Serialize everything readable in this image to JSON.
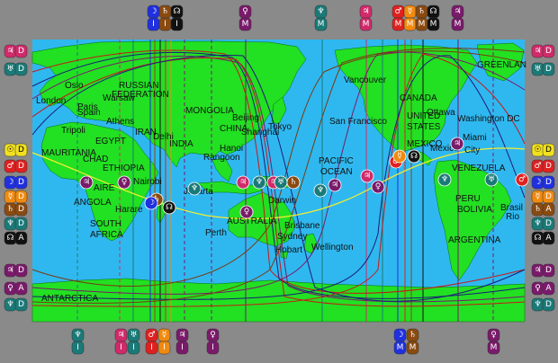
{
  "colors": {
    "ocean": "#2fb8ef",
    "land": "#22e022",
    "frame": "#8a8a8a",
    "grid": "#000000",
    "path_yellow": "#f4ee30",
    "line_red": "#c81818",
    "line_navy": "#1c1c7a",
    "line_purple": "#7a1a6a",
    "line_brown": "#7a3a10"
  },
  "cities": [
    {
      "name": "London"
    },
    {
      "name": "Oslo"
    },
    {
      "name": "Paris"
    },
    {
      "name": "Warsaw"
    },
    {
      "name": "Spain"
    },
    {
      "name": "Athens"
    },
    {
      "name": "Tripoli"
    },
    {
      "name": "EGYPT"
    },
    {
      "name": "IRAN"
    },
    {
      "name": "Delhi"
    },
    {
      "name": "INDIA"
    },
    {
      "name": "CHINA"
    },
    {
      "name": "Beijing"
    },
    {
      "name": "Shanghai"
    },
    {
      "name": "Tokyo"
    },
    {
      "name": "Hanoi"
    },
    {
      "name": "Rangoon"
    },
    {
      "name": "Jakarta"
    },
    {
      "name": "Darwin"
    },
    {
      "name": "Perth"
    },
    {
      "name": "Brisbane"
    },
    {
      "name": "Sydney"
    },
    {
      "name": "Hobart"
    },
    {
      "name": "Wellington"
    },
    {
      "name": "Nairobi"
    },
    {
      "name": "Harare"
    },
    {
      "name": "ETHIOPIA"
    },
    {
      "name": "CHAD"
    },
    {
      "name": "AIRE"
    },
    {
      "name": "Vancouver"
    },
    {
      "name": "San Francisco"
    },
    {
      "name": "Ottawa"
    },
    {
      "name": "Washington DC"
    },
    {
      "name": "Miami"
    },
    {
      "name": "City"
    },
    {
      "name": "Mexico"
    },
    {
      "name": "PERU"
    },
    {
      "name": "Rio"
    }
  ],
  "regions": [
    {
      "name": "RUSSIAN"
    },
    {
      "name": "FEDERATION"
    },
    {
      "name": "MONGOLIA"
    },
    {
      "name": "MAURITANIA"
    },
    {
      "name": "ANGOLA"
    },
    {
      "name": "SOUTH"
    },
    {
      "name": "AFRICA"
    },
    {
      "name": "AUSTRALIA"
    },
    {
      "name": "PACIFIC"
    },
    {
      "name": "OCEAN"
    },
    {
      "name": "CANADA"
    },
    {
      "name": "UNITED"
    },
    {
      "name": "STATES"
    },
    {
      "name": "MEXICO"
    },
    {
      "name": "VENEZUELA"
    },
    {
      "name": "BOLIVIA"
    },
    {
      "name": "Brasil"
    },
    {
      "name": "ARGENTINA"
    },
    {
      "name": "ANTARCTICA"
    },
    {
      "name": "GREENLAN"
    }
  ],
  "left_badges": [
    {
      "sym": "♃",
      "sub": "D",
      "color": "#d02a6a"
    },
    {
      "sym": "♅",
      "sub": "D",
      "color": "#1a7a78"
    },
    {
      "sym": "☉",
      "sub": "D",
      "color": "#f0e020"
    },
    {
      "sym": "♂",
      "sub": "D",
      "color": "#e02020"
    },
    {
      "sym": "☽",
      "sub": "D",
      "color": "#2030e0"
    },
    {
      "sym": "☿",
      "sub": "D",
      "color": "#f08a10"
    },
    {
      "sym": "♄",
      "sub": "D",
      "color": "#8a4a10"
    },
    {
      "sym": "♆",
      "sub": "D",
      "color": "#1a7a78"
    },
    {
      "sym": "☊",
      "sub": "A",
      "color": "#111111"
    },
    {
      "sym": "♃",
      "sub": "D",
      "color": "#7a1a6a"
    },
    {
      "sym": "♀",
      "sub": "A",
      "color": "#7a1a6a"
    },
    {
      "sym": "♆",
      "sub": "D",
      "color": "#1a7a78"
    }
  ],
  "right_badges": [
    {
      "sym": "♃",
      "sub": "D",
      "color": "#d02a6a"
    },
    {
      "sym": "♅",
      "sub": "D",
      "color": "#1a7a78"
    },
    {
      "sym": "☉",
      "sub": "D",
      "color": "#f0e020"
    },
    {
      "sym": "♂",
      "sub": "D",
      "color": "#e02020"
    },
    {
      "sym": "☽",
      "sub": "D",
      "color": "#2030e0"
    },
    {
      "sym": "☿",
      "sub": "D",
      "color": "#f08a10"
    },
    {
      "sym": "♄",
      "sub": "A",
      "color": "#8a4a10"
    },
    {
      "sym": "♆",
      "sub": "D",
      "color": "#1a7a78"
    },
    {
      "sym": "☊",
      "sub": "A",
      "color": "#111111"
    },
    {
      "sym": "♃",
      "sub": "D",
      "color": "#7a1a6a"
    },
    {
      "sym": "♀",
      "sub": "A",
      "color": "#7a1a6a"
    },
    {
      "sym": "♆",
      "sub": "D",
      "color": "#1a7a78"
    }
  ],
  "top_badges": [
    {
      "sym": "☽",
      "sub": "I",
      "color": "#2030e0"
    },
    {
      "sym": "♄",
      "sub": "I",
      "color": "#8a4a10"
    },
    {
      "sym": "☊",
      "sub": "I",
      "color": "#111111"
    },
    {
      "sym": "♀",
      "sub": "M",
      "color": "#7a1a6a"
    },
    {
      "sym": "♆",
      "sub": "M",
      "color": "#1a7a78"
    },
    {
      "sym": "♃",
      "sub": "M",
      "color": "#d02a6a"
    },
    {
      "sym": "♂",
      "sub": "M",
      "color": "#e02020"
    },
    {
      "sym": "☿",
      "sub": "M",
      "color": "#f08a10"
    },
    {
      "sym": "♄",
      "sub": "M",
      "color": "#8a4a10"
    },
    {
      "sym": "☊",
      "sub": "M",
      "color": "#111111"
    },
    {
      "sym": "♃",
      "sub": "M",
      "color": "#7a1a6a"
    }
  ],
  "bottom_badges": [
    {
      "sym": "♆",
      "sub": "I",
      "color": "#1a7a78"
    },
    {
      "sym": "♃",
      "sub": "I",
      "color": "#d02a6a"
    },
    {
      "sym": "♅",
      "sub": "I",
      "color": "#1a7a78"
    },
    {
      "sym": "♂",
      "sub": "I",
      "color": "#e02020"
    },
    {
      "sym": "☿",
      "sub": "I",
      "color": "#f08a10"
    },
    {
      "sym": "♃",
      "sub": "I",
      "color": "#7a1a6a"
    },
    {
      "sym": "♀",
      "sub": "I",
      "color": "#7a1a6a"
    },
    {
      "sym": "☽",
      "sub": "M",
      "color": "#2030e0"
    },
    {
      "sym": "♄",
      "sub": "M",
      "color": "#8a4a10"
    },
    {
      "sym": "♀",
      "sub": "M",
      "color": "#7a1a6a"
    }
  ],
  "map_markers": [
    {
      "sym": "♃",
      "color": "#7a1a6a"
    },
    {
      "sym": "♀",
      "color": "#7a1a6a"
    },
    {
      "sym": "♄",
      "color": "#8a4a10"
    },
    {
      "sym": "☊",
      "color": "#111111"
    },
    {
      "sym": "☽",
      "color": "#2030e0"
    },
    {
      "sym": "♆",
      "color": "#1a7a78"
    },
    {
      "sym": "♃",
      "color": "#d02a6a"
    },
    {
      "sym": "♆",
      "color": "#1a7a78"
    },
    {
      "sym": "♃",
      "color": "#d02a6a"
    },
    {
      "sym": "♅",
      "color": "#1a7a78"
    },
    {
      "sym": "♄",
      "color": "#8a4a10"
    },
    {
      "sym": "♀",
      "color": "#7a1a6a"
    },
    {
      "sym": "♃",
      "color": "#7a1a6a"
    },
    {
      "sym": "♆",
      "color": "#1a7a78"
    },
    {
      "sym": "♃",
      "color": "#d02a6a"
    },
    {
      "sym": "♂",
      "color": "#e02020"
    },
    {
      "sym": "☿",
      "color": "#f08a10"
    },
    {
      "sym": "☊",
      "color": "#111111"
    },
    {
      "sym": "♀",
      "color": "#7a1a6a"
    },
    {
      "sym": "♃",
      "color": "#7a1a6a"
    },
    {
      "sym": "♅",
      "color": "#1a7a78"
    },
    {
      "sym": "♆",
      "color": "#1a7a78"
    },
    {
      "sym": "♂",
      "color": "#e02020"
    }
  ]
}
